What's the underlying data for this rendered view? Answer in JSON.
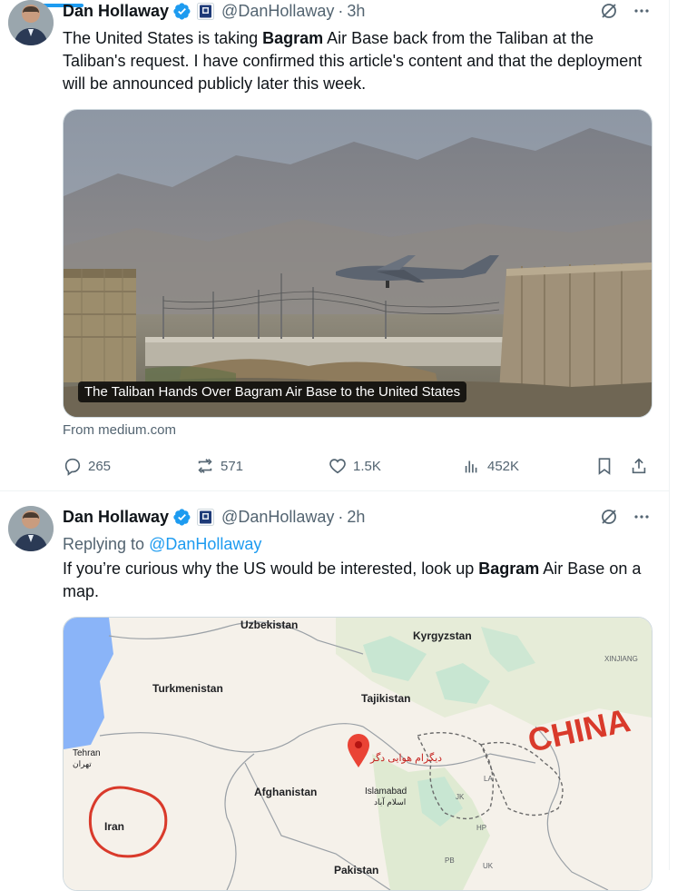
{
  "tweet1": {
    "name": "Dan Hollaway",
    "handle": "@DanHollaway",
    "time": "3h",
    "text_parts": [
      "The United States is taking ",
      "Bagram",
      " Air Base back from the Taliban at the Taliban's request. I have confirmed this article's content and that the deployment will be announced publicly later this week."
    ],
    "card_caption": "The Taliban Hands Over Bagram Air Base to the United States",
    "card_source": "From medium.com",
    "replies": "265",
    "reposts": "571",
    "likes": "1.5K",
    "views": "452K"
  },
  "tweet2": {
    "name": "Dan Hollaway",
    "handle": "@DanHollaway",
    "time": "2h",
    "replying_prefix": "Replying to",
    "replying_to": "@DanHollaway",
    "text_parts": [
      "If you’re curious why the US would be interested, look up ",
      "Bagram",
      " Air Base on a map."
    ],
    "map_labels": {
      "uzbekistan": "Uzbekistan",
      "kyrgyzstan": "Kyrgyzstan",
      "xinjiang": "XINJIANG",
      "turkmenistan": "Turkmenistan",
      "tajikistan": "Tajikistan",
      "china_annotation": "CHINA",
      "tehran": "Tehran",
      "tehran_native": "تهران",
      "bagram_native": "دیگرام هوایی دگر",
      "afghanistan": "Afghanistan",
      "islamabad": "Islamabad",
      "islamabad_native": "اسلام آباد",
      "jk": "JK",
      "la": "LA",
      "iran": "Iran",
      "hp": "HP",
      "pakistan": "Pakistan",
      "pb": "PB",
      "uk": "UK"
    }
  },
  "colors": {
    "accent": "#1d9bf0",
    "annotation_red": "#d93a2b",
    "secondary_text": "#536471"
  }
}
